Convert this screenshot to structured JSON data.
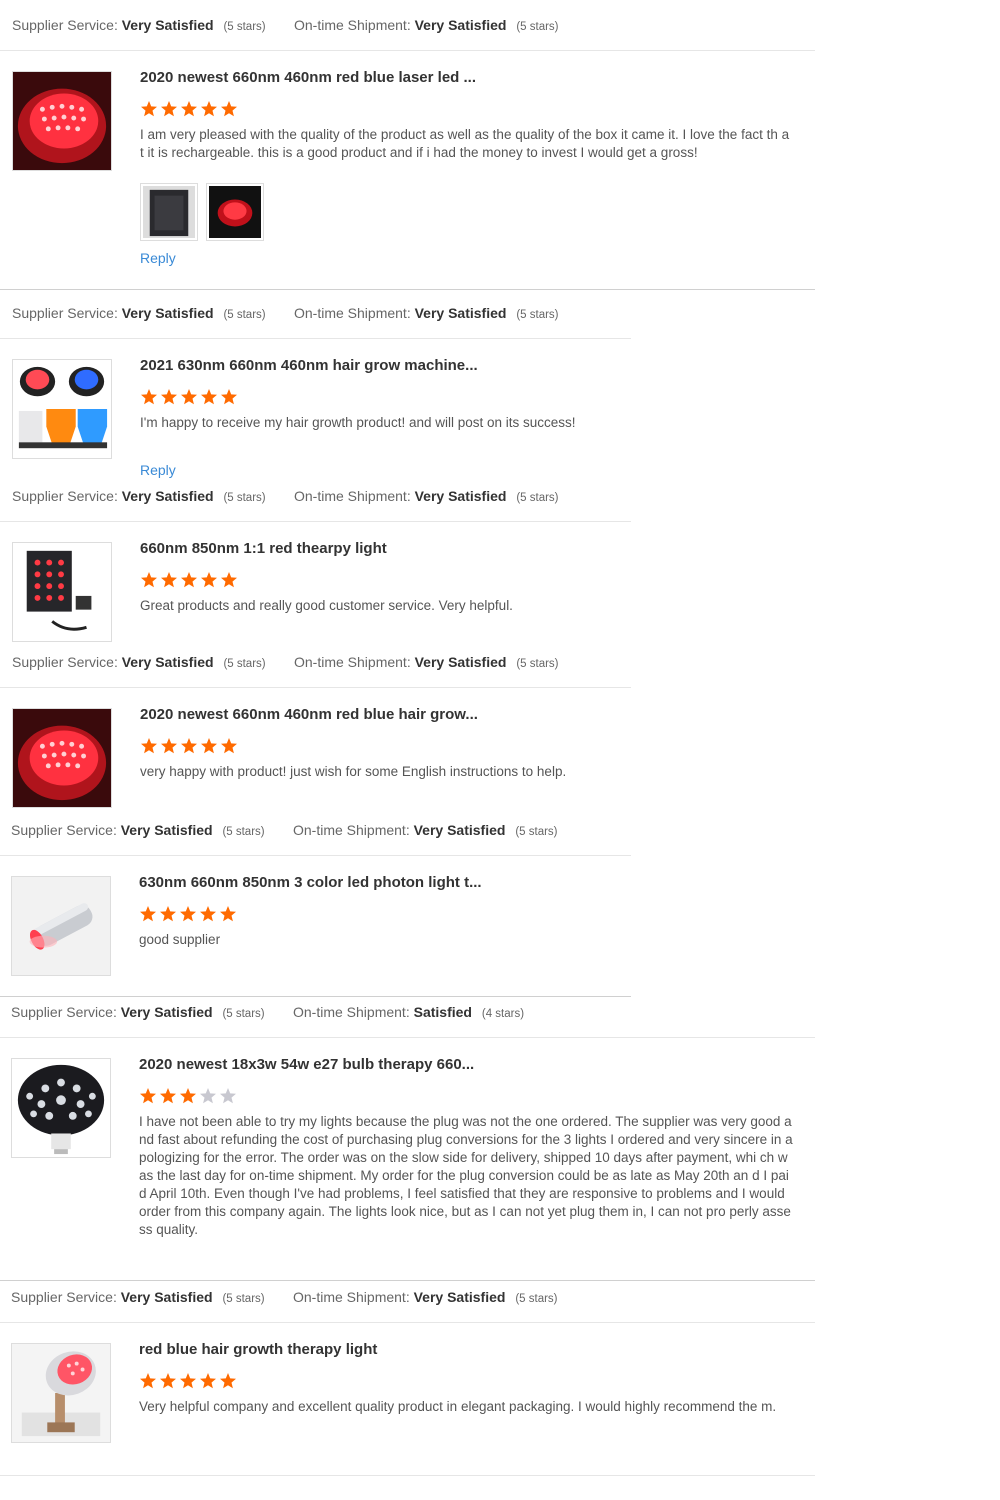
{
  "colors": {
    "star_on": "#ff6a00",
    "star_off": "#c8c8d0",
    "link": "#3a8ad6"
  },
  "labels": {
    "supplier_service": "Supplier Service:",
    "on_time_shipment": "On-time Shipment:"
  },
  "reply_label": "Reply",
  "reviews": [
    {
      "supplier_service": "Very Satisfied",
      "supplier_stars": "(5 stars)",
      "shipment": "Very Satisfied",
      "shipment_stars": "(5 stars)",
      "thumb_icon": "red-led-cap-icon",
      "title": "2020 newest 660nm 460nm red blue laser led ...",
      "rating": 5,
      "text": "I am very pleased with the quality of the product as well as the quality of the box it came it. I love the fact th at it is rechargeable. this is a good product and if i had the money to invest I would get a gross!",
      "has_photos": true,
      "photo_icons": [
        "box-photo-icon",
        "red-cap-photo-icon"
      ]
    },
    {
      "supplier_service": "Very Satisfied",
      "supplier_stars": "(5 stars)",
      "shipment": "Very Satisfied",
      "shipment_stars": "(5 stars)",
      "thumb_icon": "multicolor-led-caps-icon",
      "title": "2021 630nm 660nm 460nm hair grow machine...",
      "rating": 5,
      "text": "I'm happy to receive my hair growth product! and will post on its success!"
    },
    {
      "supplier_service": "Very Satisfied",
      "supplier_stars": "(5 stars)",
      "shipment": "Very Satisfied",
      "shipment_stars": "(5 stars)",
      "thumb_icon": "led-panel-icon",
      "title": "660nm 850nm 1:1 red thearpy light",
      "rating": 5,
      "text": "Great products and really good customer service. Very helpful."
    },
    {
      "supplier_service": "Very Satisfied",
      "supplier_stars": "(5 stars)",
      "shipment": "Very Satisfied",
      "shipment_stars": "(5 stars)",
      "thumb_icon": "red-led-cap-icon",
      "title": "2020 newest 660nm 460nm red blue hair grow...",
      "rating": 5,
      "text": "very happy with product!  just wish for some English instructions to help."
    },
    {
      "supplier_service": "Very Satisfied",
      "supplier_stars": "(5 stars)",
      "shipment": "Very Satisfied",
      "shipment_stars": "(5 stars)",
      "thumb_icon": "led-torch-icon",
      "title": "630nm 660nm 850nm 3 color led photon light t...",
      "rating": 5,
      "text": "good supplier"
    },
    {
      "supplier_service": "Very Satisfied",
      "supplier_stars": "(5 stars)",
      "shipment": "Satisfied",
      "shipment_stars": "(4 stars)",
      "thumb_icon": "led-bulb-icon",
      "title": "2020 newest 18x3w 54w e27 bulb therapy 660...",
      "rating": 3,
      "text": "I have not been able to try my lights because the plug was not the one ordered.  The supplier was very good and fast about refunding the cost of purchasing plug conversions for the 3 lights I ordered and very sincere in apologizing for the error.  The order was on the slow side for delivery, shipped 10 days after payment, whi ch was the last day for on-time shipment.  My order for the plug conversion could be as late as May 20th an d I paid April 10th.  Even though I've had problems, I feel satisfied that they are responsive to problems and I would order from this company again.  The lights look nice, but as I can not yet plug them in, I can not pro perly assess quality."
    },
    {
      "supplier_service": "Very Satisfied",
      "supplier_stars": "(5 stars)",
      "shipment": "Very Satisfied",
      "shipment_stars": "(5 stars)",
      "thumb_icon": "lamp-clamp-icon",
      "title": "red blue hair growth therapy light",
      "rating": 5,
      "text": "Very helpful company and excellent quality product in elegant packaging.  I would highly recommend the m."
    }
  ]
}
